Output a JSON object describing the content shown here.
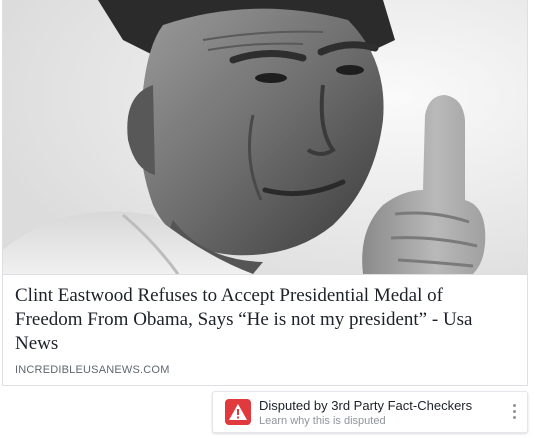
{
  "post": {
    "image": {
      "label": "black-and-white portrait photo",
      "tone": "grayscale"
    },
    "headline": "Clint Eastwood Refuses to Accept Presidential Medal of Freedom From Obama, Says “He is not my president” - Usa News",
    "domain": "INCREDIBLEUSANEWS.COM"
  },
  "dispute": {
    "icon": "warning-triangle-icon",
    "icon_color": "#e0393e",
    "title": "Disputed by 3rd Party Fact-Checkers",
    "subtitle": "Learn why this is disputed",
    "menu_icon": "more-vertical-icon"
  }
}
